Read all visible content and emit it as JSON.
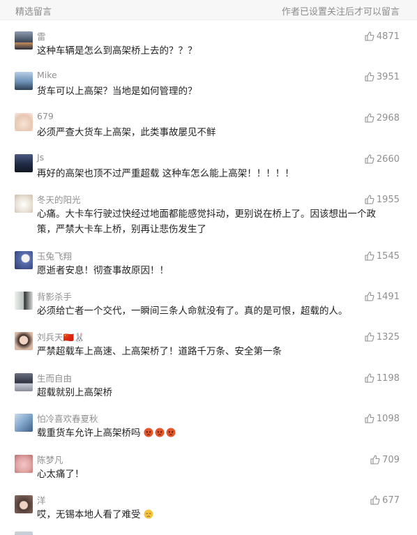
{
  "header": {
    "left_title": "精选留言",
    "right_note": "作者已设置关注后才可以留言"
  },
  "comments": [
    {
      "nickname": "雷",
      "text": "这种车辆是怎么到高架桥上去的？？？",
      "likes": "4871",
      "avatar_color": "#3b4556"
    },
    {
      "nickname": "Mike",
      "text": "货车可以上高架？当地是如何管理的？",
      "likes": "3951",
      "avatar_color": "#6a8fb5"
    },
    {
      "nickname": "679",
      "text": "必须严查大货车上高架，此类事故屡见不鲜",
      "likes": "2968",
      "avatar_color": "#f2d6c6"
    },
    {
      "nickname": "Js",
      "text": "再好的高架也顶不过严重超载 这种车怎么能上高架！！！！！",
      "likes": "2660",
      "avatar_color": "#1f2a44"
    },
    {
      "nickname": "冬天的阳光",
      "text": "心痛。大卡车行驶过快经过地面都能感觉抖动，更别说在桥上了。因该想出一个政策，严禁大卡车上桥，别再让悲伤发生了",
      "likes": "1955",
      "avatar_color": "#e9e2d6"
    },
    {
      "nickname": "玉兔飞翔",
      "text": "愿逝者安息！彻查事故原因！！",
      "likes": "1545",
      "avatar_color": "#5a6fb0"
    },
    {
      "nickname": "背影杀手",
      "text": "必须给亡者一个交代，一瞬间三条人命就没有了。真的是可恨，超载的人。",
      "likes": "1491",
      "avatar_color": "#b8c1bb"
    },
    {
      "nickname": "刘兵天🇨🇳🐰",
      "text": "严禁超载车上高速、上高架桥了！道路千万条、安全第一条",
      "likes": "1325",
      "avatar_color": "#d9b8a5"
    },
    {
      "nickname": "生而自由",
      "text": "超载就别上高架桥",
      "likes": "1198",
      "avatar_color": "#2d3140"
    },
    {
      "nickname": "怕冷喜欢春夏秋",
      "text": "载重货车允许上高架桥吗",
      "likes": "1098",
      "avatar_color": "#7fa3c8",
      "emoji_count": 3
    },
    {
      "nickname": "陈梦凡",
      "text": "心太痛了！",
      "likes": "709",
      "avatar_color": "#e2a7a7"
    },
    {
      "nickname": "洋",
      "text": "哎，无锡本地人看了难受",
      "likes": "677",
      "avatar_color": "#4d3b35",
      "emoji_count": 1
    }
  ],
  "icons": {
    "like": "thumbs-up-icon",
    "angry_face": "angry-face-emoji",
    "sad_face": "sad-face-emoji"
  },
  "colors": {
    "header_bg": "#f7f7f7",
    "nickname": "#8f8f8f",
    "body_text": "#222222",
    "likes_text": "#8f8f8f",
    "emoji_red": "#e8562d"
  }
}
